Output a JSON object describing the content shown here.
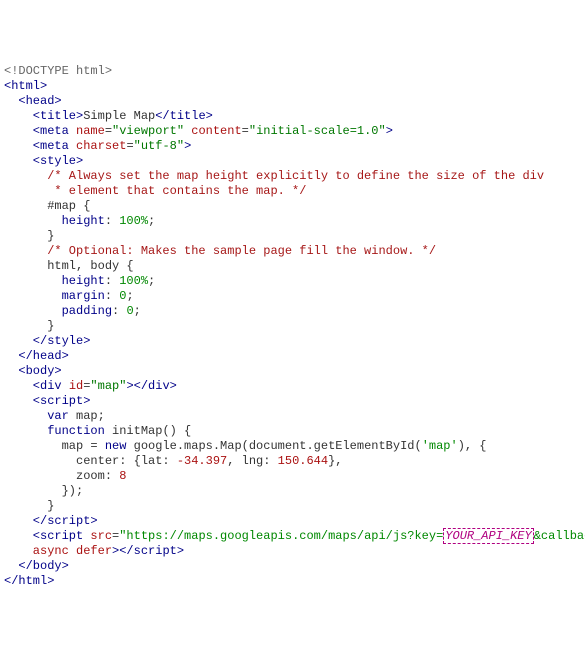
{
  "code": {
    "doctype": "<!DOCTYPE html>",
    "tag_html_open": "<html>",
    "tag_head_open": "  <head>",
    "title_line": {
      "pre": "    <title>",
      "text": "Simple Map",
      "post": "</title>"
    },
    "meta_viewport": {
      "pre": "    <meta ",
      "a1": "name",
      "v1": "\"viewport\"",
      "a2": "content",
      "v2": "\"initial-scale=1.0\"",
      "post": ">"
    },
    "meta_charset": {
      "pre": "    <meta ",
      "a1": "charset",
      "v1": "\"utf-8\"",
      "post": ">"
    },
    "style_open": "    <style>",
    "comment1a": "      /* Always set the map height explicitly to define the size of the div",
    "comment1b": "       * element that contains the map. */",
    "css_map_sel": "      #map {",
    "css_rule1_prop": "        height",
    "css_rule1_val": "100%",
    "css_close1": "      }",
    "comment2": "      /* Optional: Makes the sample page fill the window. */",
    "css_body_sel": "      html, body {",
    "css_rule2a_prop": "        height",
    "css_rule2a_val": "100%",
    "css_rule2b_prop": "        margin",
    "css_rule2b_val": "0",
    "css_rule2c_prop": "        padding",
    "css_rule2c_val": "0",
    "css_close2": "      }",
    "style_close": "    </style>",
    "head_close": "  </head>",
    "body_open": "  <body>",
    "div_map": {
      "pre": "    <div ",
      "a1": "id",
      "v1": "\"map\"",
      "post": "></div>"
    },
    "script_open": "    <script>",
    "js_var": "      var",
    "js_mapdecl": " map;",
    "js_fn": "      function",
    "js_fnname": " initMap() {",
    "js_line3a": "        map = ",
    "js_new": "new",
    "js_line3b": " google.maps.Map(document.getElementById(",
    "js_mapstr": "'map'",
    "js_line3c": "), {",
    "js_center": "          center: {lat: ",
    "js_lat": "-34.397",
    "js_lng_p": ", lng: ",
    "js_lng": "150.644",
    "js_center_end": "},",
    "js_zoom_p": "          zoom: ",
    "js_zoom": "8",
    "js_close_obj": "        });",
    "js_close_fn": "      }",
    "script_close_inline": "    </script>",
    "script_ext": {
      "pre": "    <script ",
      "a1": "src",
      "url": "\"https://maps.googleapis.com/maps/api/js?key=",
      "callout": "YOUR_API_KEY",
      "url2": "&callback=initMap\"",
      "line2": "    async defer",
      "close": "></script>"
    },
    "body_close": "  </body>",
    "html_close": "</html>"
  },
  "chart_data": null
}
